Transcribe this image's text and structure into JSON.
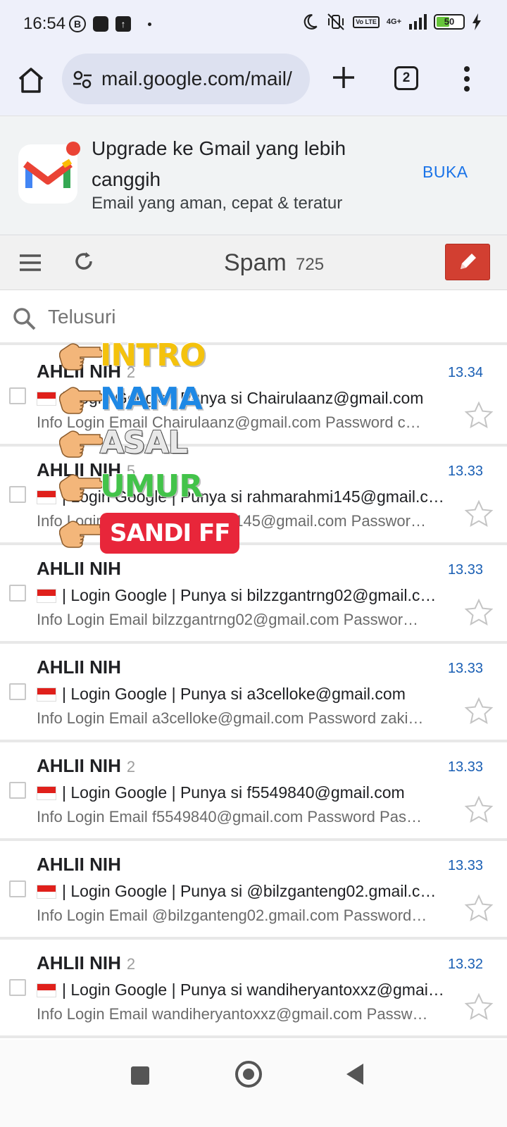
{
  "status_bar": {
    "time": "16:54",
    "b_badge": "B",
    "network": "4G+",
    "volte": "Vo LTE",
    "battery_level": "50",
    "battery_fraction": 0.5
  },
  "browser": {
    "url": "mail.google.com/mail/",
    "tab_count": "2"
  },
  "promo": {
    "title": "Upgrade ke Gmail yang lebih canggih",
    "subtitle": "Email yang aman, cepat & teratur",
    "button": "BUKA"
  },
  "header": {
    "folder": "Spam",
    "count": "725"
  },
  "search": {
    "placeholder": "Telusuri"
  },
  "emails": [
    {
      "sender": "AHLII NIH",
      "count": "2",
      "time": "13.34",
      "subject": "| Login Google | Punya si Chairulaanz@gmail.com",
      "snippet": "Info Login Email Chairulaanz@gmail.com Password c…"
    },
    {
      "sender": "AHLII NIH",
      "count": "5",
      "time": "13.33",
      "subject": "| Login Google | Punya si rahmarahmi145@gmail.c…",
      "snippet": "Info Login Email rahmarahmi145@gmail.com Passwor…"
    },
    {
      "sender": "AHLII NIH",
      "count": "",
      "time": "13.33",
      "subject": "| Login Google | Punya si bilzzgantrng02@gmail.co…",
      "snippet": "Info Login Email bilzzgantrng02@gmail.com Passwor…"
    },
    {
      "sender": "AHLII NIH",
      "count": "",
      "time": "13.33",
      "subject": "| Login Google | Punya si a3celloke@gmail.com",
      "snippet": "Info Login Email a3celloke@gmail.com Password zaki…"
    },
    {
      "sender": "AHLII NIH",
      "count": "2",
      "time": "13.33",
      "subject": "| Login Google | Punya si f5549840@gmail.com",
      "snippet": "Info Login Email f5549840@gmail.com Password Pas…"
    },
    {
      "sender": "AHLII NIH",
      "count": "",
      "time": "13.33",
      "subject": "| Login Google | Punya si @bilzganteng02.gmail.co…",
      "snippet": "Info Login Email @bilzganteng02.gmail.com Password…"
    },
    {
      "sender": "AHLII NIH",
      "count": "2",
      "time": "13.32",
      "subject": "| Login Google | Punya si wandiheryantoxxz@gmai…",
      "snippet": "Info Login Email wandiheryantoxxz@gmail.com Passw…"
    }
  ],
  "overlay": {
    "labels": [
      "INTRO",
      "NAMA",
      "ASAL",
      "UMUR",
      "SANDI FF"
    ]
  },
  "colors": {
    "accent": "#1a73e8",
    "compose": "#d23f31",
    "time": "#1a5fb4"
  }
}
